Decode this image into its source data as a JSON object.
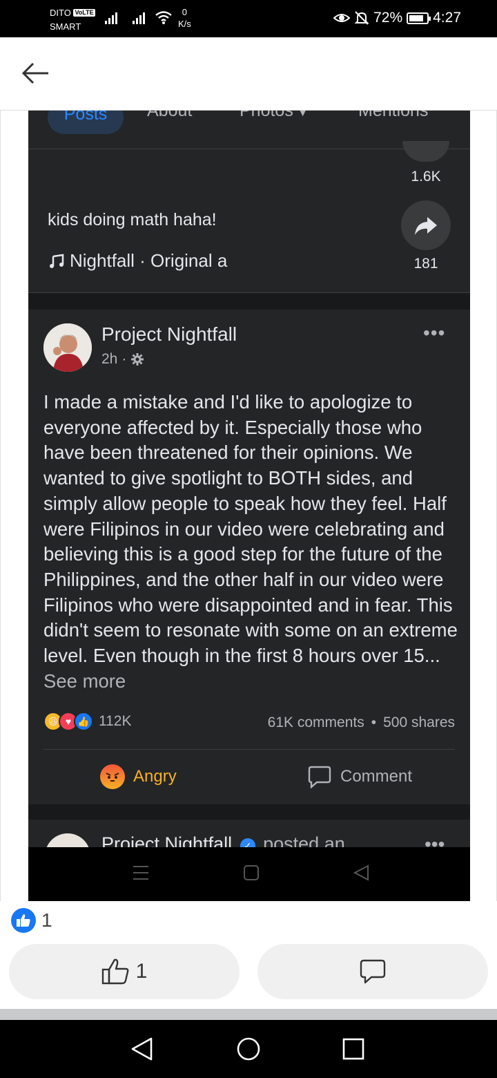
{
  "status_bar": {
    "carrier_top": "DITO",
    "volte": "VoLTE",
    "carrier_bottom": "SMART",
    "speed_value": "0",
    "speed_unit": "K/s",
    "battery": "72%",
    "time": "4:27"
  },
  "screenshot": {
    "tabs": [
      "Posts",
      "About",
      "Photos",
      "Mentions"
    ],
    "reel": {
      "count_top": "1.6K",
      "caption": "kids doing math haha!",
      "music": "Nightfall · Original a",
      "share_count": "181"
    },
    "post": {
      "author": "Project Nightfall",
      "time": "2h",
      "more": "•••",
      "text": "I made a mistake and I'd like to apologize to everyone affected by it. Especially those who have been threatened for their opinions. We wanted to give spotlight to BOTH sides, and simply allow people to speak how they feel. Half were Filipinos in our video were celebrating and believing this is a good step for the future of the Philippines, and the other half in our video were Filipinos who were disappointed and in fear. This didn't seem to resonate with some on an extreme level. Even though in the first 8 hours over 15...",
      "see_more": "See more",
      "reactions_count": "112K",
      "comments": "61K comments",
      "separator": "•",
      "shares": "500 shares",
      "action_reaction": "Angry",
      "action_comment": "Comment"
    },
    "next_post": {
      "author": "Project Nightfall",
      "verified": "✓",
      "suffix": "posted an",
      "more": "•••"
    }
  },
  "outer": {
    "like_count": "1",
    "like_button_count": "1"
  },
  "colors": {
    "facebook_blue": "#1877f2",
    "dark_card": "#242526",
    "dark_bg": "#18191a",
    "angry_orange": "#f7b125"
  }
}
